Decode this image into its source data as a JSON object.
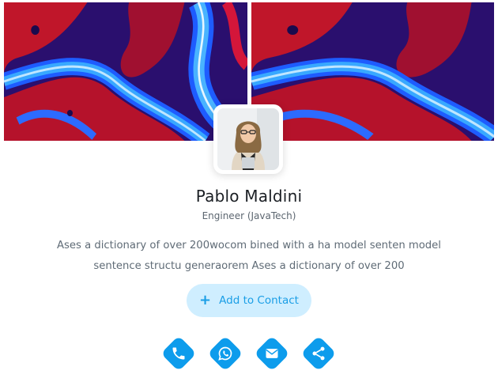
{
  "profile": {
    "name": "Pablo Maldini",
    "role": "Engineer (JavaTech)",
    "bio": "Ases a dictionary of over 200wocom bined with a ha model senten model sentence structu generaorem Ases a dictionary of over 200"
  },
  "add_contact": {
    "label": "Add to Contact",
    "icon": "plus-icon"
  },
  "actions": [
    {
      "name": "phone",
      "icon": "phone-icon"
    },
    {
      "name": "whatsapp",
      "icon": "whatsapp-icon"
    },
    {
      "name": "email",
      "icon": "envelope-icon"
    },
    {
      "name": "share",
      "icon": "share-icon"
    }
  ],
  "colors": {
    "accent": "#0d9cec",
    "button_bg": "#cfeeff",
    "button_text": "#1a9ee6",
    "name_text": "#1b1f24",
    "body_text": "#5f6b76"
  }
}
